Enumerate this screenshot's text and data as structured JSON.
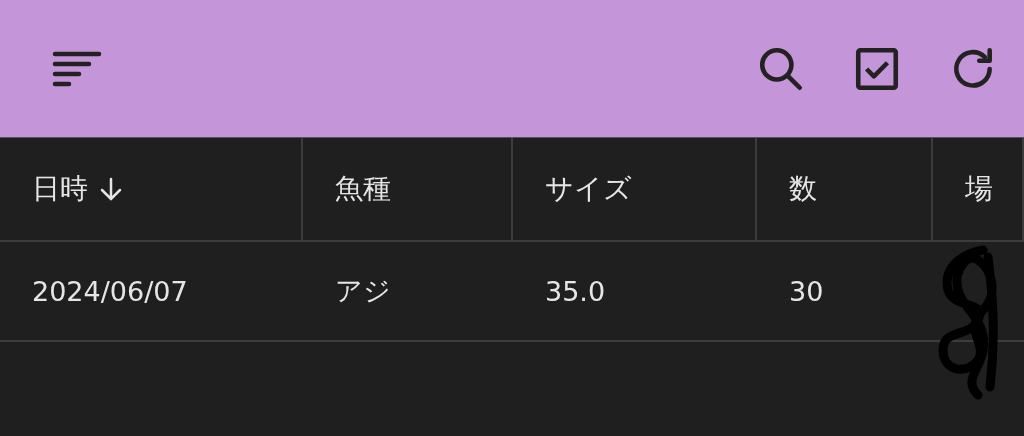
{
  "toolbar": {
    "actions": [
      {
        "kind": "search"
      },
      {
        "kind": "select"
      },
      {
        "kind": "refresh"
      }
    ]
  },
  "table": {
    "columns": [
      {
        "label": "日時",
        "sorted": true
      },
      {
        "label": "魚種",
        "sorted": false
      },
      {
        "label": "サイズ",
        "sorted": false
      },
      {
        "label": "数",
        "sorted": false
      },
      {
        "label": "場",
        "sorted": false
      }
    ],
    "rows": [
      {
        "cells": [
          "2024/06/07",
          "アジ",
          "35.0",
          "30"
        ]
      }
    ]
  }
}
